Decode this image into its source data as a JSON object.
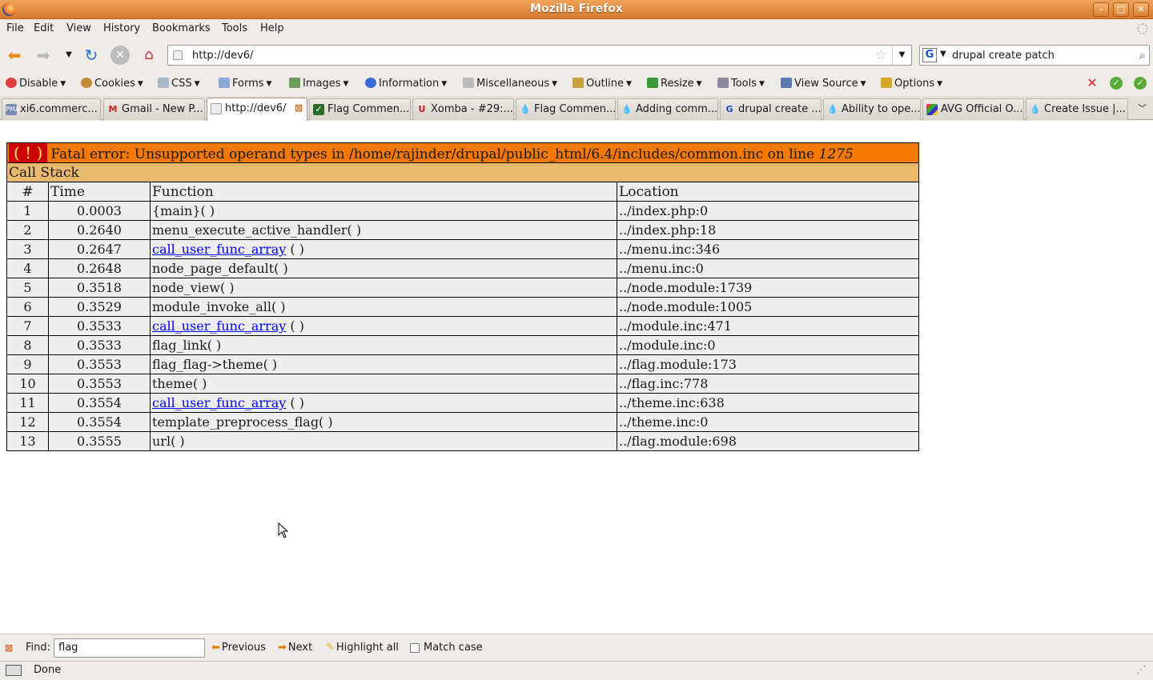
{
  "window": {
    "title": "Mozilla Firefox"
  },
  "menubar": {
    "items": [
      "File",
      "Edit",
      "View",
      "History",
      "Bookmarks",
      "Tools",
      "Help"
    ]
  },
  "nav": {
    "url": "http://dev6/",
    "search_query": "drupal create patch",
    "search_engine_icon": "google-icon"
  },
  "devtoolbar": {
    "items": [
      "Disable",
      "Cookies",
      "CSS",
      "Forms",
      "Images",
      "Information",
      "Miscellaneous",
      "Outline",
      "Resize",
      "Tools",
      "View Source",
      "Options"
    ]
  },
  "tabs": [
    {
      "label": "xi6.commerc...",
      "icon": "phpmyadmin-icon"
    },
    {
      "label": "Gmail - New P...",
      "icon": "gmail-icon"
    },
    {
      "label": "http://dev6/",
      "icon": "page-icon",
      "active": true
    },
    {
      "label": "Flag Commen...",
      "icon": "check-icon"
    },
    {
      "label": "Xomba - #29:...",
      "icon": "xomba-icon"
    },
    {
      "label": "Flag Commen...",
      "icon": "drupal-icon"
    },
    {
      "label": "Adding comm...",
      "icon": "drupal-icon"
    },
    {
      "label": "drupal create ...",
      "icon": "google-icon"
    },
    {
      "label": "Ability to ope...",
      "icon": "drupal-icon"
    },
    {
      "label": "AVG Official O...",
      "icon": "avg-icon"
    },
    {
      "label": "Create Issue |...",
      "icon": "drupal-icon"
    }
  ],
  "error": {
    "bang": "( ! )",
    "message": "Fatal error: Unsupported operand types in /home/rajinder/drupal/public_html/6.4/includes/common.inc on line ",
    "line": "1275",
    "callstack_label": "Call Stack",
    "headers": {
      "num": "#",
      "time": "Time",
      "function": "Function",
      "location": "Location"
    },
    "rows": [
      {
        "num": "1",
        "time": "0.0003",
        "func": "{main}( )",
        "link": false,
        "loc": "../index.php:0"
      },
      {
        "num": "2",
        "time": "0.2640",
        "func": "menu_execute_active_handler( )",
        "link": false,
        "loc": "../index.php:18"
      },
      {
        "num": "3",
        "time": "0.2647",
        "func": "call_user_func_array",
        "args": " ( )",
        "link": true,
        "loc": "../menu.inc:346"
      },
      {
        "num": "4",
        "time": "0.2648",
        "func": "node_page_default( )",
        "link": false,
        "loc": "../menu.inc:0"
      },
      {
        "num": "5",
        "time": "0.3518",
        "func": "node_view( )",
        "link": false,
        "loc": "../node.module:1739"
      },
      {
        "num": "6",
        "time": "0.3529",
        "func": "module_invoke_all( )",
        "link": false,
        "loc": "../node.module:1005"
      },
      {
        "num": "7",
        "time": "0.3533",
        "func": "call_user_func_array",
        "args": " ( )",
        "link": true,
        "loc": "../module.inc:471"
      },
      {
        "num": "8",
        "time": "0.3533",
        "func": "flag_link( )",
        "link": false,
        "loc": "../module.inc:0"
      },
      {
        "num": "9",
        "time": "0.3553",
        "func": "flag_flag->theme( )",
        "link": false,
        "loc": "../flag.module:173"
      },
      {
        "num": "10",
        "time": "0.3553",
        "func": "theme( )",
        "link": false,
        "loc": "../flag.inc:778"
      },
      {
        "num": "11",
        "time": "0.3554",
        "func": "call_user_func_array",
        "args": " ( )",
        "link": true,
        "loc": "../theme.inc:638"
      },
      {
        "num": "12",
        "time": "0.3554",
        "func": "template_preprocess_flag( )",
        "link": false,
        "loc": "../theme.inc:0"
      },
      {
        "num": "13",
        "time": "0.3555",
        "func": "url( )",
        "link": false,
        "loc": "../flag.module:698"
      }
    ]
  },
  "findbar": {
    "label": "Find:",
    "value": "flag",
    "previous": "Previous",
    "next": "Next",
    "highlight": "Highlight all",
    "match_case": "Match case"
  },
  "status": {
    "text": "Done"
  }
}
